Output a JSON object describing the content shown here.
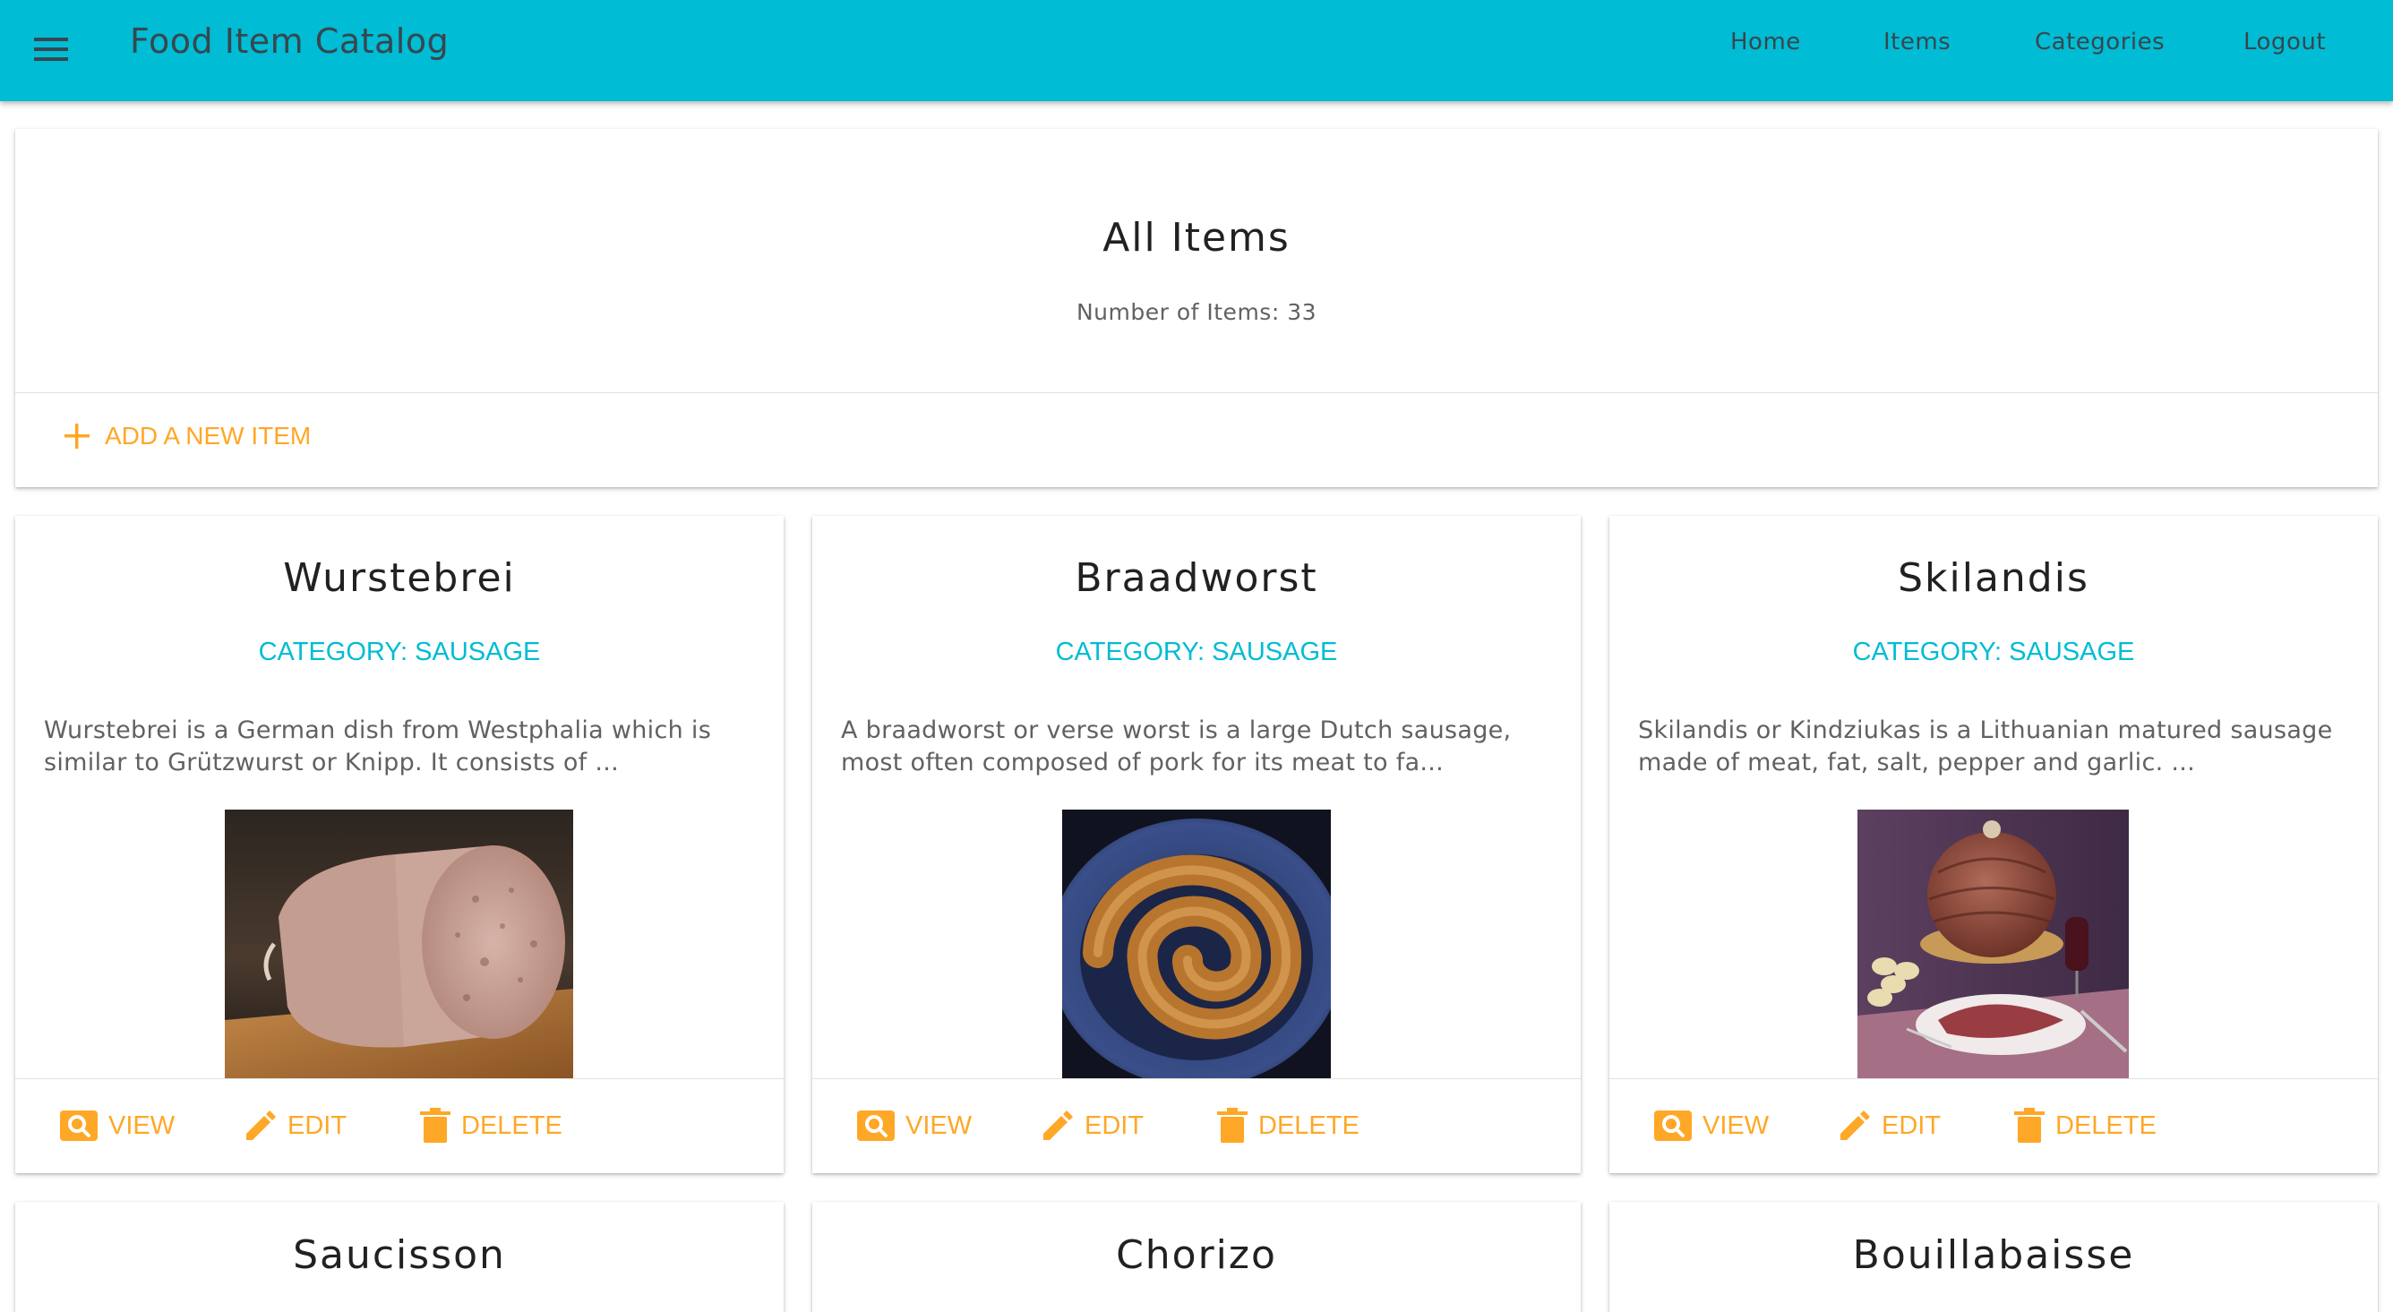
{
  "app": {
    "title": "Food Item Catalog"
  },
  "nav": {
    "items": [
      "Home",
      "Items",
      "Categories",
      "Logout"
    ]
  },
  "header": {
    "title": "All Items",
    "count_text": "Number of Items: 33",
    "add_label": "ADD A NEW ITEM"
  },
  "actions": {
    "view": "VIEW",
    "edit": "EDIT",
    "delete": "DELETE"
  },
  "items": [
    {
      "name": "Wurstebrei",
      "category": "CATEGORY: SAUSAGE",
      "description": "Wurstebrei is a German dish from Westphalia which is similar to Grützwurst or Knipp. It consists of ...",
      "image": "sausage-roll-photo"
    },
    {
      "name": "Braadworst",
      "category": "CATEGORY: SAUSAGE",
      "description": "A braadworst or verse worst is a large Dutch sausage, most often composed of pork for its meat to fa...",
      "image": "coiled-sausage-photo"
    },
    {
      "name": "Skilandis",
      "category": "CATEGORY: SAUSAGE",
      "description": "Skilandis or Kindziukas is a Lithuanian matured sausage made of meat, fat, salt, pepper and garlic. ...",
      "image": "matured-sausage-photo"
    }
  ],
  "more_items": [
    "Saucisson",
    "Chorizo",
    "Bouillabaisse"
  ],
  "colors": {
    "primary": "#00bcd4",
    "accent": "#ffa726",
    "text": "#212121",
    "muted": "#616161"
  }
}
